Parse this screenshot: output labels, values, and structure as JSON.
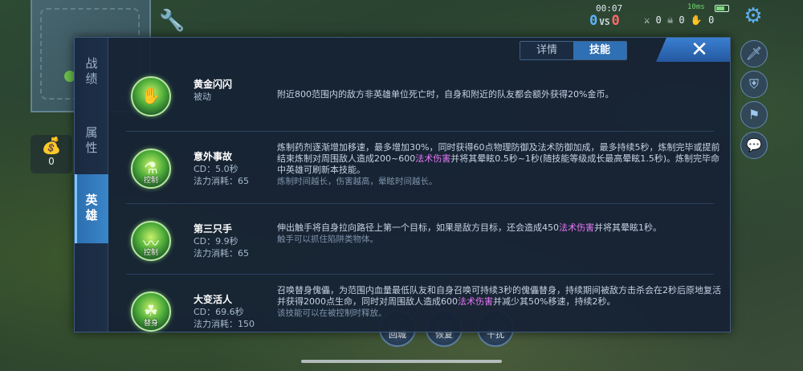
{
  "hud": {
    "time": "00:07",
    "score_blue": "0",
    "vs": "VS",
    "score_red": "0",
    "kills": "0",
    "deaths": "0",
    "assists": "0",
    "fps": "10ms"
  },
  "gold": {
    "count": "0"
  },
  "panel": {
    "side_tabs": [
      "战绩",
      "属性",
      "英雄"
    ],
    "active_side_tab": "英雄",
    "top_tabs": [
      "详情",
      "技能"
    ],
    "active_top_tab": "技能",
    "close_glyph": "✕"
  },
  "skills": [
    {
      "name": "黄金闪闪",
      "line1": "被动",
      "line2": "",
      "tag": "",
      "desc_before": "附近800范围内的敌方非英雄单位死亡时，自身和附近的队友都会额外获得20%金币。",
      "desc_magic": "",
      "desc_after": "",
      "note": ""
    },
    {
      "name": "意外事故",
      "line1": "CD：5.0秒",
      "line2": "法力消耗：65",
      "tag": "控制",
      "desc_before": "炼制药剂逐渐增加移速，最多增加30%，同时获得60点物理防御及法术防御加成，最多持续5秒，炼制完毕或提前结束炼制对周围敌人造成200~600",
      "desc_magic": "法术伤害",
      "desc_after": "并将其晕眩0.5秒~1秒(随技能等级成长最高晕眩1.5秒)。炼制完毕命中英雄可刷新本技能。",
      "note": "炼制时间越长，伤害越高，晕眩时间越长。"
    },
    {
      "name": "第三只手",
      "line1": "CD：9.9秒",
      "line2": "法力消耗：65",
      "tag": "控制",
      "desc_before": "伸出触手将自身拉向路径上第一个目标，如果是敌方目标，还会造成450",
      "desc_magic": "法术伤害",
      "desc_after": "并将其晕眩1秒。",
      "note": "触手可以抓住陷阱类物体。"
    },
    {
      "name": "大变活人",
      "line1": "CD：69.6秒",
      "line2": "法力消耗：150",
      "tag": "替身",
      "desc_before": "召唤替身傀儡，为范围内血量最低队友和自身召唤可持续3秒的傀儡替身，持续期间被敌方击杀会在2秒后原地复活并获得2000点生命，同时对周围敌人造成600",
      "desc_magic": "法术伤害",
      "desc_after": "并减少其50%移速，持续2秒。",
      "note": "该技能可以在被控制时释放。"
    }
  ],
  "bottom_buttons": [
    "回城",
    "恢复",
    "干扰"
  ]
}
